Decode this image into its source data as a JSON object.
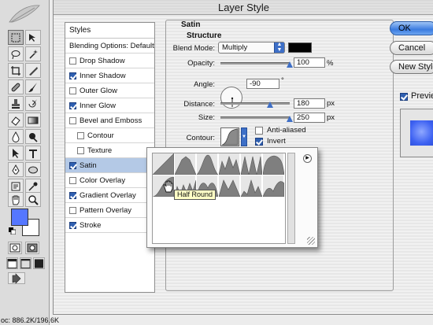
{
  "doc_status": "oc: 886.2K/196.6K",
  "dialog": {
    "title": "Layer Style",
    "styles_header": "Styles",
    "list_items": [
      {
        "label": "Blending Options: Default",
        "checkbox": false,
        "checked": false,
        "sub": false,
        "selected": false
      },
      {
        "label": "Drop Shadow",
        "checkbox": true,
        "checked": false,
        "sub": false,
        "selected": false
      },
      {
        "label": "Inner Shadow",
        "checkbox": true,
        "checked": true,
        "sub": false,
        "selected": false
      },
      {
        "label": "Outer Glow",
        "checkbox": true,
        "checked": false,
        "sub": false,
        "selected": false
      },
      {
        "label": "Inner Glow",
        "checkbox": true,
        "checked": true,
        "sub": false,
        "selected": false
      },
      {
        "label": "Bevel and Emboss",
        "checkbox": true,
        "checked": false,
        "sub": false,
        "selected": false
      },
      {
        "label": "Contour",
        "checkbox": true,
        "checked": false,
        "sub": true,
        "selected": false
      },
      {
        "label": "Texture",
        "checkbox": true,
        "checked": false,
        "sub": true,
        "selected": false
      },
      {
        "label": "Satin",
        "checkbox": true,
        "checked": true,
        "sub": false,
        "selected": true
      },
      {
        "label": "Color Overlay",
        "checkbox": true,
        "checked": false,
        "sub": false,
        "selected": false
      },
      {
        "label": "Gradient Overlay",
        "checkbox": true,
        "checked": true,
        "sub": false,
        "selected": false
      },
      {
        "label": "Pattern Overlay",
        "checkbox": true,
        "checked": false,
        "sub": false,
        "selected": false
      },
      {
        "label": "Stroke",
        "checkbox": true,
        "checked": true,
        "sub": false,
        "selected": false
      }
    ],
    "satin": {
      "heading": "Satin",
      "structure_heading": "Structure",
      "blend_mode_label": "Blend Mode:",
      "blend_mode_value": "Multiply",
      "color": "#000000",
      "opacity_label": "Opacity:",
      "opacity_value": "100",
      "opacity_unit": "%",
      "opacity_level": 1.0,
      "angle_label": "Angle:",
      "angle_value": "-90",
      "angle_unit": "°",
      "distance_label": "Distance:",
      "distance_value": "180",
      "distance_unit": "px",
      "distance_level": 0.72,
      "size_label": "Size:",
      "size_value": "250",
      "size_unit": "px",
      "size_level": 1.0,
      "contour_label": "Contour:",
      "anti_aliased_label": "Anti-aliased",
      "anti_aliased": false,
      "invert_label": "Invert",
      "invert": true
    },
    "buttons": {
      "ok": "OK",
      "cancel": "Cancel",
      "new_style": "New Style...",
      "preview": "Preview"
    },
    "preview_checked": true,
    "contour_tooltip": "Half Round",
    "accent_color": "#3d6fc7",
    "foreground_color": "#5577ff"
  }
}
